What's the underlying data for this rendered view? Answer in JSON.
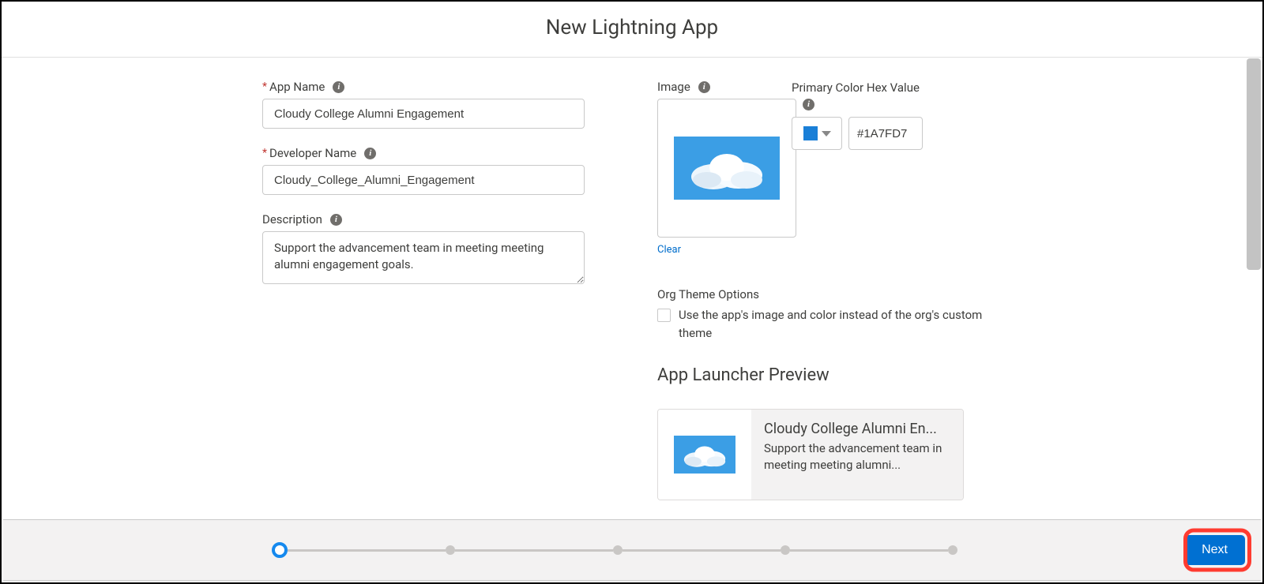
{
  "title": "New Lightning App",
  "form": {
    "app_name": {
      "label": "App Name",
      "required": true,
      "value": "Cloudy College Alumni Engagement"
    },
    "developer_name": {
      "label": "Developer Name",
      "required": true,
      "value": "Cloudy_College_Alumni_Engagement"
    },
    "description": {
      "label": "Description",
      "value": "Support the advancement team in meeting meeting alumni engagement goals."
    },
    "image": {
      "label": "Image",
      "clear_label": "Clear"
    },
    "primary_color": {
      "label": "Primary Color Hex Value",
      "hex": "#1A7FD7"
    },
    "org_theme": {
      "label": "Org Theme Options",
      "checkbox_label": "Use the app's image and color instead of the org's custom theme",
      "checked": false
    }
  },
  "preview": {
    "heading": "App Launcher Preview",
    "title": "Cloudy College Alumni En...",
    "desc": "Support the advancement team in meeting meeting alumni..."
  },
  "footer": {
    "next_label": "Next",
    "step_count": 5,
    "current_step": 1
  },
  "info_glyph": "i"
}
